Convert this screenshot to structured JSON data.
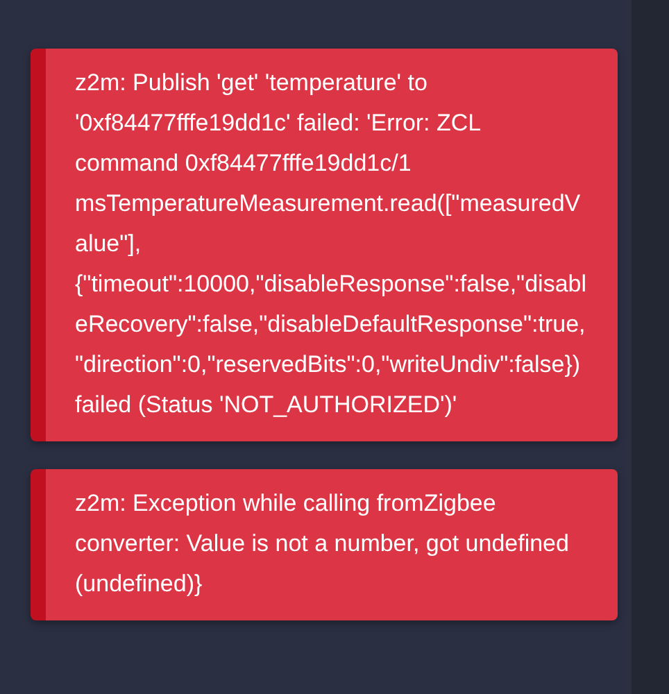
{
  "notifications": [
    {
      "message": "z2m: Publish 'get' 'temperature' to '0xf84477fffe19dd1c' failed: 'Error: ZCL command 0xf84477fffe19dd1c/1 msTemperatureMeasurement.read([\"measuredValue\"], {\"timeout\":10000,\"disableResponse\":false,\"disableRecovery\":false,\"disableDefaultResponse\":true,\"direction\":0,\"reservedBits\":0,\"writeUndiv\":false}) failed (Status 'NOT_AUTHORIZED')'"
    },
    {
      "message": "z2m: Exception while calling fromZigbee converter: Value is not a number, got undefined (undefined)}"
    }
  ]
}
